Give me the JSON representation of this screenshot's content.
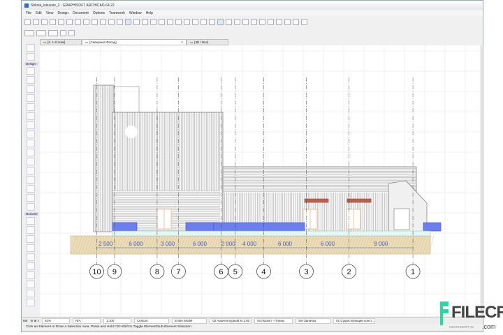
{
  "window": {
    "title": "Shkola_iskusstv_2 - GRAPHISOFT ARCHICAD-64 22"
  },
  "menu": [
    "File",
    "Edit",
    "View",
    "Design",
    "Document",
    "Options",
    "Teamwork",
    "Window",
    "Help"
  ],
  "tabs": [
    {
      "label": "[0. 1-й этаж]",
      "icon": "floorplan-icon"
    },
    {
      "label": "[Северный Фасад]",
      "icon": "elevation-icon",
      "active": true
    },
    {
      "label": "[3D / Все]",
      "icon": "3d-icon"
    }
  ],
  "toolbox": {
    "groups": [
      "Design",
      "Docume"
    ]
  },
  "drawing": {
    "axes": [
      "10",
      "9",
      "8",
      "7",
      "6",
      "5",
      "4",
      "3",
      "2",
      "1"
    ],
    "dimensions": [
      2500,
      6000,
      3000,
      6000,
      2000,
      4000,
      6000,
      6000,
      9000
    ],
    "dimension_labels": [
      "2 500",
      "6 000",
      "3 000",
      "6 000",
      "2 000",
      "4 000",
      "6 000",
      "6 000",
      "9 000"
    ],
    "colors": {
      "railing": "#6d7ff0",
      "ground": "#ecdcb8",
      "dimension": "#3d5ad8",
      "door": "#e8a15a",
      "awning": "#c0604f"
    }
  },
  "status": {
    "zoom": "81%",
    "angle": "N/A",
    "scale": "1:100",
    "layer_combo": "Custom",
    "model": "Entire Model",
    "pen_set": "02 Архитектурный М 1:50",
    "view_mode": "04 Проект - Планы",
    "renovation": "Set Заначка",
    "structure": "01 Существующие конст...",
    "units": "Mtr"
  },
  "message": "Click an Element or Draw a Selection Area. Press and Hold Ctrl+Shift to Toggle Element/Sub-Element Selection.",
  "brand": "GRAPHISOFT ID",
  "logo": {
    "text": "FILECR",
    "suffix": ".com"
  }
}
